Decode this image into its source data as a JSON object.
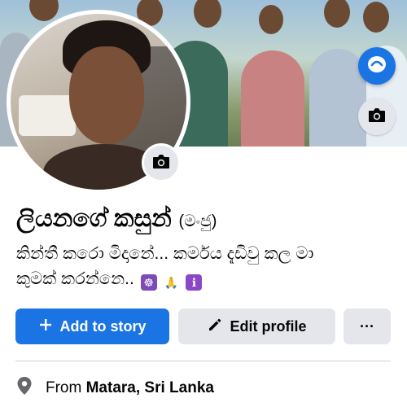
{
  "profile": {
    "name": "ලියනගේ කසුන්",
    "nickname": "(මංජු)",
    "bio_line1": "කින්තී කරො මිදානේ... කර්මය දැඩිවු කල මා",
    "bio_line2": "කුමක් කරන්නෙ..",
    "bio_emojis": [
      "☸",
      "🙏",
      "ℹ"
    ]
  },
  "actions": {
    "add_story_label": "Add to story",
    "edit_profile_label": "Edit profile",
    "more_label": "···"
  },
  "intro": {
    "location_prefix": "From",
    "location_value": "Matara, Sri Lanka"
  },
  "colors": {
    "primary": "#1b74e4",
    "secondary_button": "#e4e6eb",
    "text": "#050505",
    "icon_gray": "#65676b"
  },
  "icons": {
    "cover_camera": "camera-icon",
    "avatar_camera": "camera-icon",
    "fab": "messenger-style-icon",
    "location": "map-pin-icon"
  }
}
